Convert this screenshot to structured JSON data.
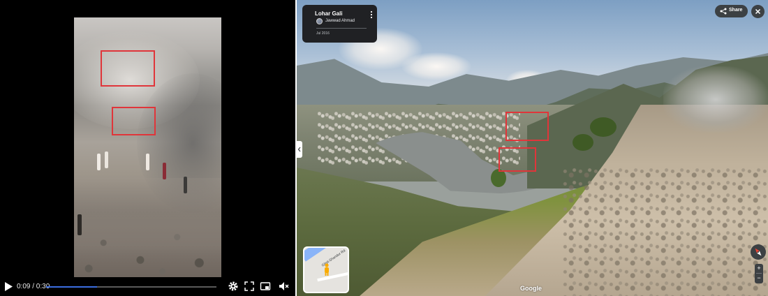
{
  "video_player": {
    "time_display": "0:09 / 0:30",
    "progress_percent": 30,
    "progress_color": "#3b6de0",
    "icons": [
      "play-icon",
      "settings-icon",
      "fullscreen-icon",
      "picture-in-picture-icon",
      "mute-icon"
    ]
  },
  "street_view": {
    "location_title": "Lohar Gali",
    "author": "Jawwad Ahmad",
    "capture_date": "Jul 2016",
    "share_label": "Share",
    "minimap_road_label": "Gilgit-Shandur Rd",
    "google_watermark": "Google",
    "zoom_in_label": "+",
    "zoom_out_label": "−",
    "icons": [
      "more-vert-icon",
      "share-icon",
      "close-icon",
      "collapse-panel-icon",
      "compass-icon",
      "pegman-icon"
    ]
  },
  "annotation_color": "#e0353a"
}
